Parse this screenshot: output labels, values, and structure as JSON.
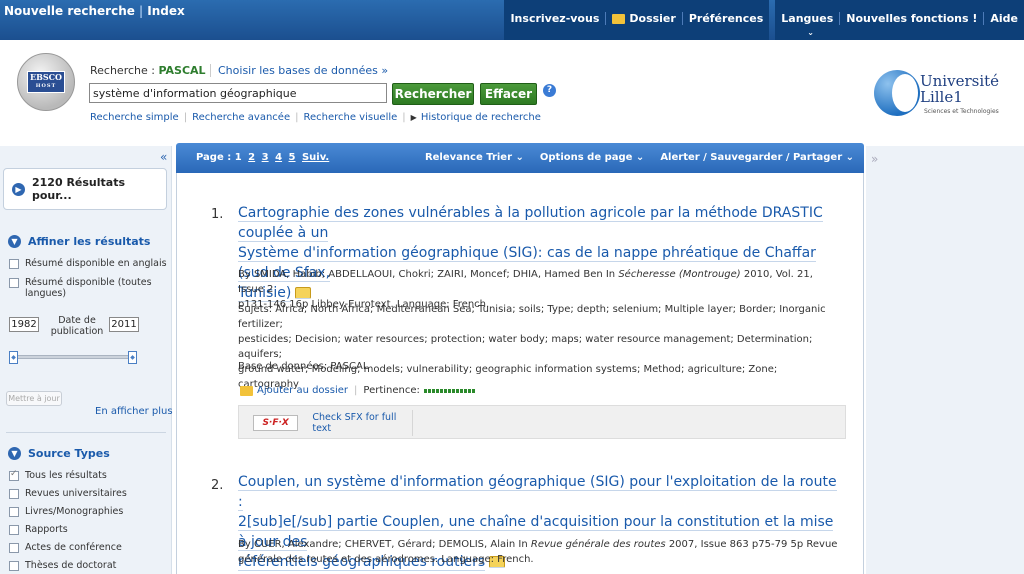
{
  "topbar": {
    "new_search": "Nouvelle recherche",
    "index": "Index",
    "subscribe": "Inscrivez-vous",
    "folder": "Dossier",
    "preferences": "Préférences",
    "languages": "Langues",
    "new_features": "Nouvelles fonctions !",
    "help": "Aide"
  },
  "search": {
    "label_prefix": "Recherche : ",
    "database": "PASCAL",
    "choose_db": "Choisir les bases de données »",
    "query": "système d'information géographique",
    "search_button": "Rechercher",
    "clear_button": "Effacer",
    "help_icon": "?",
    "links": [
      "Recherche simple",
      "Recherche avancée",
      "Recherche visuelle",
      "Historique de recherche"
    ]
  },
  "logo": {
    "ebsco_top": "EBSCO",
    "ebsco_bottom": "HOST",
    "univ_name_1": "Université",
    "univ_name_2": "Lille1",
    "univ_sub": "Sciences et Technologies"
  },
  "sidebar": {
    "collapse": "«",
    "results_count": "2120 Résultats pour...",
    "refine_title": "Affiner les résultats",
    "refine_options": [
      "Résumé disponible en anglais",
      "Résumé disponible (toutes langues)"
    ],
    "date_from": "1982",
    "date_to": "2011",
    "date_label": "Date de publication",
    "update_button": "Mettre à jour",
    "show_more": "En afficher plus »",
    "source_title": "Source Types",
    "source_types": [
      "Tous les résultats",
      "Revues universitaires",
      "Livres/Monographies",
      "Rapports",
      "Actes de conférence",
      "Thèses de doctorat"
    ]
  },
  "results_header": {
    "page_label": "Page : ",
    "current_page": "1",
    "pages": [
      "2",
      "3",
      "4",
      "5"
    ],
    "next": "Suiv.",
    "sort": "Relevance Trier ⌄",
    "page_options": "Options de page ⌄",
    "alert": "Alerter / Sauvegarder / Partager ⌄",
    "collapse_right": "»"
  },
  "results": [
    {
      "number": "1.",
      "title": "Cartographie des zones vulnérables à la pollution agricole par la méthode DRASTIC couplée à un Système d'information géographique (SIG): cas de la nappe phréatique de Chaffar (sud de Sfax, Tunisie)",
      "title_lines": [
        "Cartographie des zones vulnérables à la pollution agricole par la méthode DRASTIC couplée à un",
        "Système d'information géographique (SIG): cas de la nappe phréatique de Chaffar (sud de Sfax,",
        "Tunisie)"
      ],
      "citation_prefix": "By SMIDA, Habib; ABDELLAOUI, Chokri; ZAIRI, Moncef; DHIA, Hamed Ben In ",
      "journal": "Sécheresse (Montrouge)",
      "citation_suffix": " 2010, Vol. 21, Issue 2",
      "citation_line2": "p131-146 16p Libbey-Eurotext. Language: French.",
      "subjects_lines": [
        "Sujets: Africa; North Africa; Mediterranean Sea; Tunisia; soils; Type; depth; selenium; Multiple layer; Border; Inorganic fertilizer;",
        "pesticides; Decision; water resources; protection; water body; maps; water resource management; Determination; aquifers;",
        "ground water; Modeling; models; vulnerability; geographic information systems; Method; agriculture; Zone; cartography"
      ],
      "database": "Base de données: PASCAL",
      "add_to_folder": "Ajouter au dossier",
      "relevance_label": "Pertinence:",
      "sfx_logo": "S·F·X",
      "sfx_text": "Check SFX for full text"
    },
    {
      "number": "2.",
      "title_lines": [
        "Couplen, un système d'information géographique (SIG) pour l'exploitation de la route :",
        "2[sub]e[/sub] partie Couplen, une chaîne d'acquisition pour la constitution et la mise à jour des",
        "référentiels géographiques routiers"
      ],
      "citation_prefix": "By CUER, Alexandre; CHERVET, Gérard; DEMOLIS, Alain In ",
      "journal": "Revue générale des routes",
      "citation_suffix": " 2007, Issue 863 p75-79 5p Revue",
      "citation_line2": "générale des routes et des aérodromes. Language: French."
    }
  ]
}
